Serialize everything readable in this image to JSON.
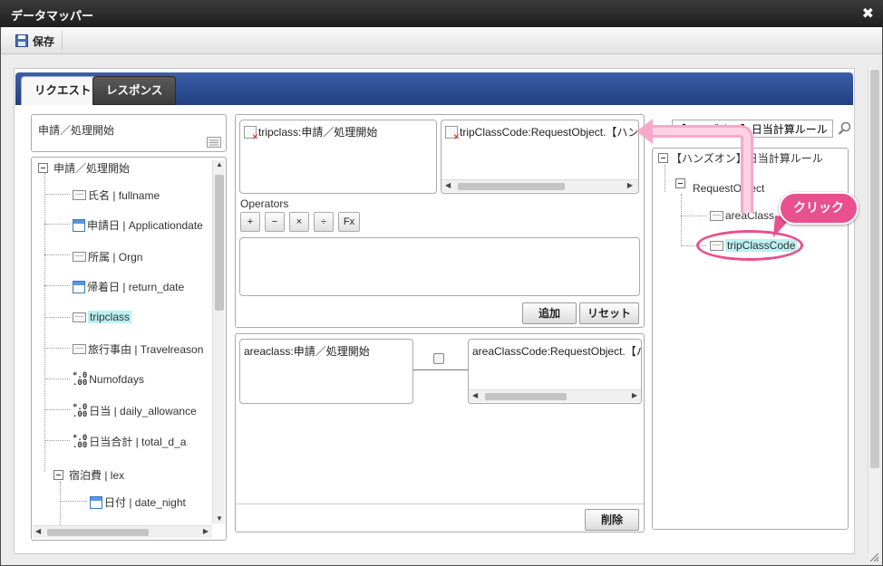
{
  "window": {
    "title": "データマッパー",
    "close_glyph": "✖"
  },
  "toolbar": {
    "save_label": "保存"
  },
  "tabs": [
    {
      "label": "リクエスト",
      "active": true
    },
    {
      "label": "レスポンス",
      "active": false
    }
  ],
  "left_panel": {
    "process_title": "申請／処理開始",
    "tree": {
      "root": "申請／処理開始",
      "items": [
        {
          "label": "氏名 | fullname",
          "icon": "field-icon"
        },
        {
          "label": "申請日 | Applicationdate",
          "icon": "calendar-icon"
        },
        {
          "label": "所属 | Orgn",
          "icon": "field-icon"
        },
        {
          "label": "帰着日 | return_date",
          "icon": "calendar-icon"
        },
        {
          "label": "tripclass",
          "icon": "field-icon",
          "highlighted": true
        },
        {
          "label": "旅行事由 | Travelreason",
          "icon": "field-icon"
        },
        {
          "label": "Numofdays",
          "icon": "number-icon"
        },
        {
          "label": "日当 | daily_allowance",
          "icon": "number-icon"
        },
        {
          "label": "日当合計 | total_d_a",
          "icon": "number-icon"
        }
      ],
      "group": {
        "label": "宿泊費 | lex",
        "items": [
          {
            "label": "日付 | date_night",
            "icon": "calendar-icon"
          }
        ]
      }
    }
  },
  "center_panel": {
    "source_box": "tripclass:申請／処理開始",
    "target_box": "tripClassCode:RequestObject.【ハンズ",
    "operators_label": "Operators",
    "operators": [
      "+",
      "−",
      "×",
      "÷",
      "Fx"
    ],
    "add_button": "追加",
    "reset_button": "リセット",
    "mapping": {
      "source": "areaclass:申請／処理開始",
      "target": "areaClassCode:RequestObject.【ハ"
    },
    "delete_button": "削除"
  },
  "right_panel": {
    "search_value": "【ハンズオン】日当計算ルール",
    "tree": {
      "root": "【ハンズオン】日当計算ルール",
      "child": "RequestObject",
      "items": [
        {
          "label": "areaClass"
        },
        {
          "label": "tripClassCode",
          "highlighted": true
        }
      ]
    }
  },
  "callout": {
    "label": "クリック",
    "color": "#e8508e"
  }
}
